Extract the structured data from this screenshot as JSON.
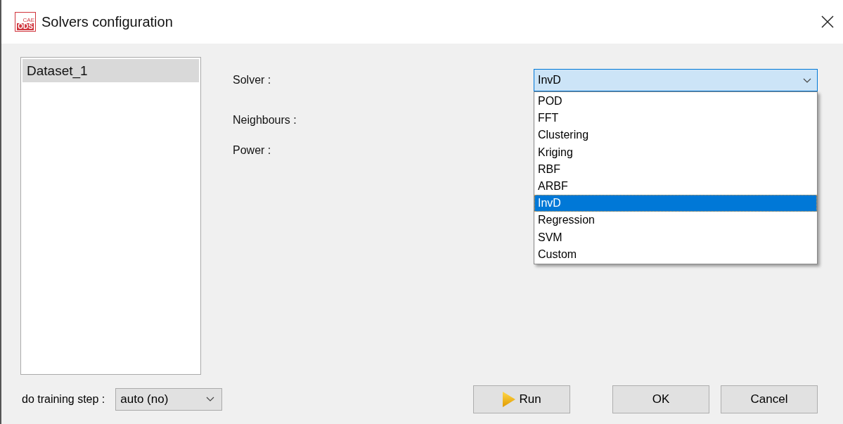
{
  "window": {
    "title": "Solvers configuration",
    "logo": {
      "text": "ODS",
      "subtext": "CAE"
    }
  },
  "datasets": [
    {
      "label": "Dataset_1",
      "selected": true
    }
  ],
  "form": {
    "fields": [
      {
        "label": "Solver :"
      },
      {
        "label": "Neighbours :"
      },
      {
        "label": "Power :"
      }
    ],
    "solver": {
      "value": "InvD",
      "expanded": true,
      "options": [
        {
          "label": "POD",
          "selected": false
        },
        {
          "label": "FFT",
          "selected": false
        },
        {
          "label": "Clustering",
          "selected": false
        },
        {
          "label": "Kriging",
          "selected": false
        },
        {
          "label": "RBF",
          "selected": false
        },
        {
          "label": "ARBF",
          "selected": false
        },
        {
          "label": "InvD",
          "selected": true
        },
        {
          "label": "Regression",
          "selected": false
        },
        {
          "label": "SVM",
          "selected": false
        },
        {
          "label": "Custom",
          "selected": false
        }
      ]
    }
  },
  "training": {
    "label": "do training step :",
    "value": "auto (no)"
  },
  "buttons": [
    {
      "label": "Run",
      "kind": "run"
    },
    {
      "label": "OK",
      "kind": "plain"
    },
    {
      "label": "Cancel",
      "kind": "plain"
    }
  ]
}
